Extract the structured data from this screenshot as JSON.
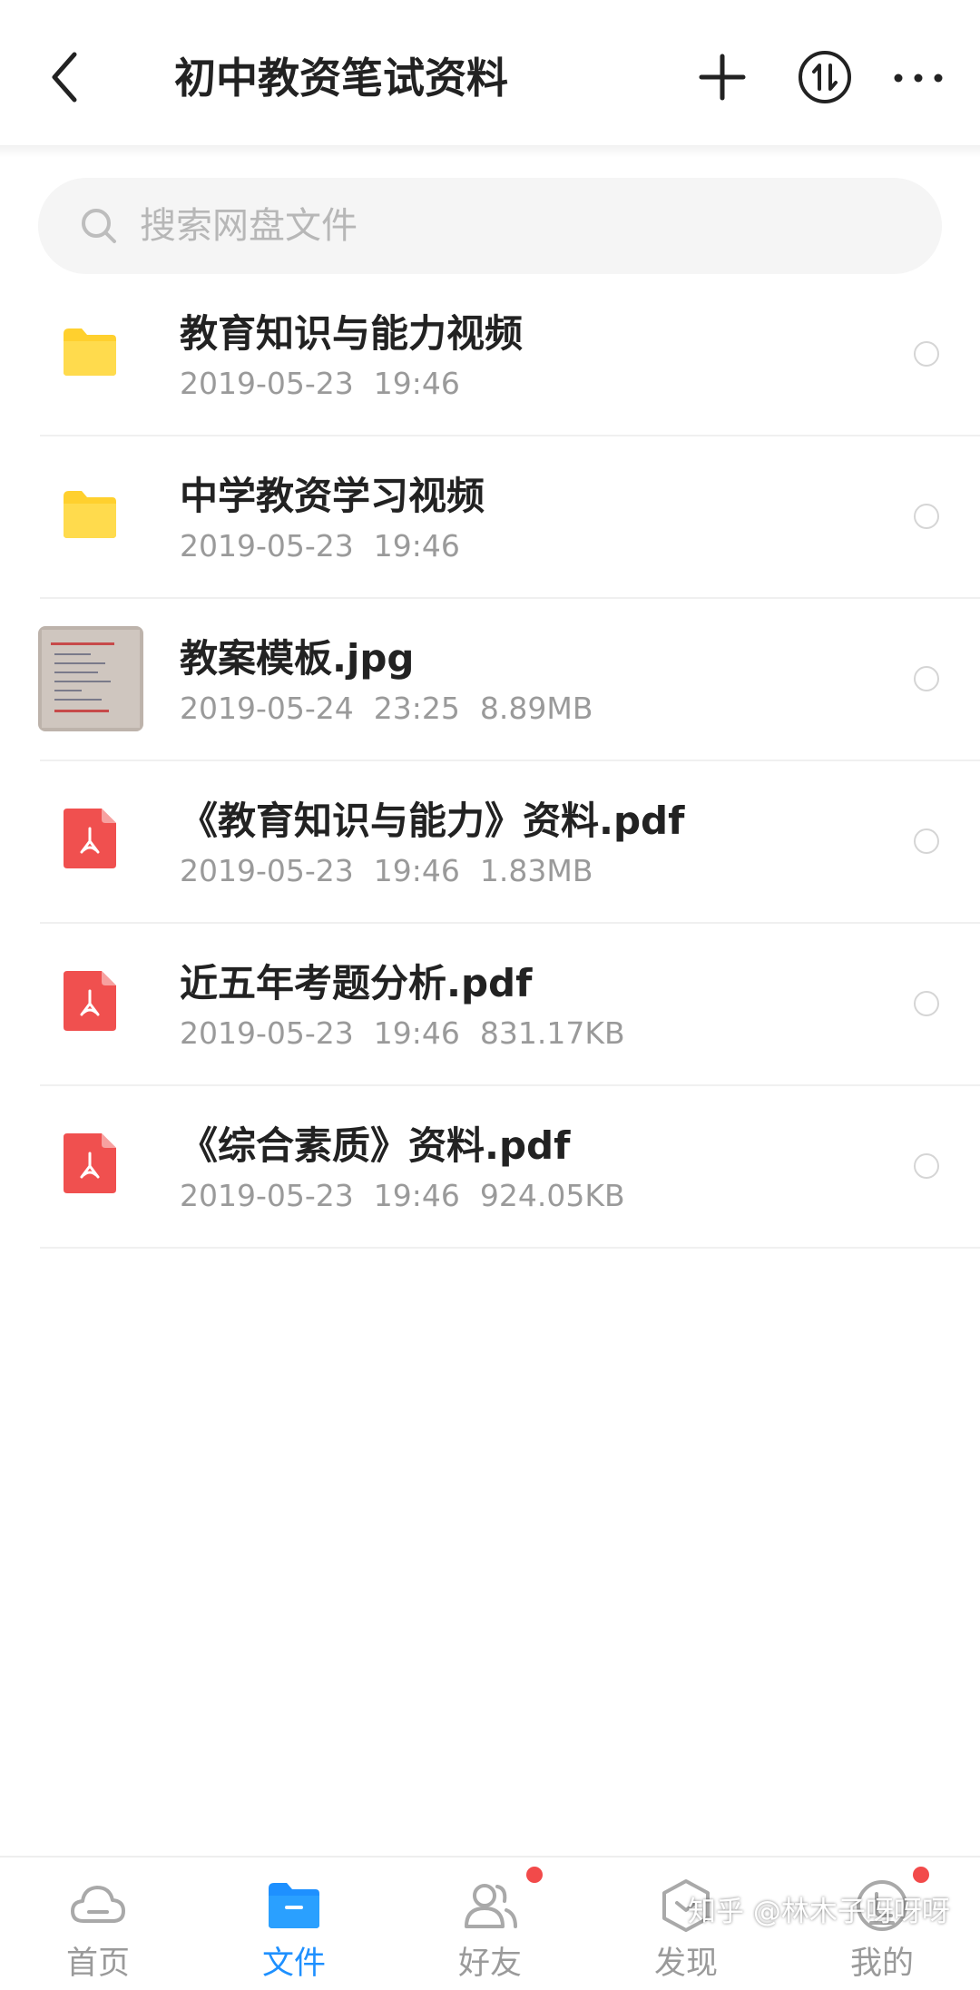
{
  "header": {
    "title": "初中教资笔试资料",
    "back_icon": "chevron-left-icon",
    "add_icon": "plus-icon",
    "sort_icon": "sort-transfer-icon",
    "more_icon": "more-horizontal-icon"
  },
  "search": {
    "placeholder": "搜索网盘文件",
    "icon": "search-icon"
  },
  "files": [
    {
      "type": "folder",
      "name": "教育知识与能力视频",
      "date": "2019-05-23",
      "time": "19:46",
      "size": ""
    },
    {
      "type": "folder",
      "name": "中学教资学习视频",
      "date": "2019-05-23",
      "time": "19:46",
      "size": ""
    },
    {
      "type": "image",
      "name": "教案模板.jpg",
      "date": "2019-05-24",
      "time": "23:25",
      "size": "8.89MB"
    },
    {
      "type": "pdf",
      "name": "《教育知识与能力》资料.pdf",
      "date": "2019-05-23",
      "time": "19:46",
      "size": "1.83MB"
    },
    {
      "type": "pdf",
      "name": "近五年考题分析.pdf",
      "date": "2019-05-23",
      "time": "19:46",
      "size": "831.17KB"
    },
    {
      "type": "pdf",
      "name": "《综合素质》资料.pdf",
      "date": "2019-05-23",
      "time": "19:46",
      "size": "924.05KB"
    }
  ],
  "nav": {
    "items": [
      {
        "label": "首页",
        "icon": "cloud-icon",
        "active": false,
        "badge": false
      },
      {
        "label": "文件",
        "icon": "folder-icon",
        "active": true,
        "badge": false
      },
      {
        "label": "好友",
        "icon": "friends-icon",
        "active": false,
        "badge": true
      },
      {
        "label": "发现",
        "icon": "discover-icon",
        "active": false,
        "badge": false
      },
      {
        "label": "我的",
        "icon": "profile-icon",
        "active": false,
        "badge": true
      }
    ]
  },
  "colors": {
    "accent": "#1e90ff",
    "folder": "#ffd02e",
    "pdf": "#f0504f",
    "badge": "#f24a4a",
    "meta_text": "#9a9a9a"
  },
  "watermark": "知乎 @林木子呀呀呀"
}
